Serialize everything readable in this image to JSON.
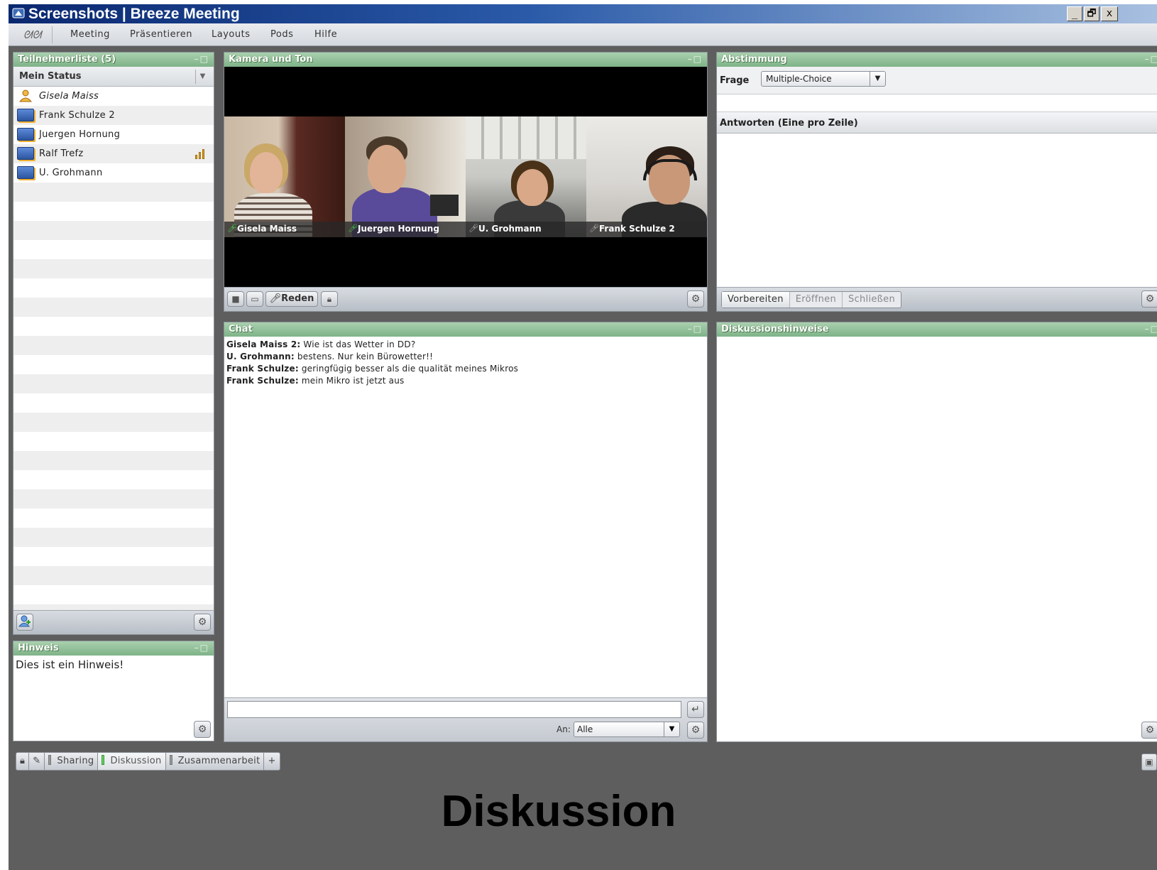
{
  "window": {
    "title": "Screenshots | Breeze Meeting",
    "minimize": "_",
    "restore": "🗗",
    "close": "x"
  },
  "menu": {
    "logo": "ᘛᘛ",
    "items": [
      "Meeting",
      "Präsentieren",
      "Layouts",
      "Pods",
      "Hilfe"
    ]
  },
  "participants": {
    "title": "Teilnehmerliste (5)",
    "controls": "–□",
    "status_label": "Mein Status",
    "status_arrow": "▼",
    "people": [
      {
        "name": "Gisela Maiss",
        "role": "host"
      },
      {
        "name": "Frank Schulze 2",
        "role": "participant"
      },
      {
        "name": "Juergen Hornung",
        "role": "participant"
      },
      {
        "name": "Ralf Trefz",
        "role": "participant",
        "signal": "signal-bars-icon"
      },
      {
        "name": "U. Grohmann",
        "role": "participant"
      }
    ]
  },
  "note": {
    "title": "Hinweis",
    "controls": "–□",
    "text": "Dies ist ein Hinweis!"
  },
  "camera": {
    "title": "Kamera und Ton",
    "controls": "–□",
    "tiles": [
      {
        "name": "Gisela Maiss",
        "mic": "on"
      },
      {
        "name": "Juergen Hornung",
        "mic": "on"
      },
      {
        "name": "U. Grohmann",
        "mic": "off"
      },
      {
        "name": "Frank Schulze 2",
        "mic": "off"
      }
    ],
    "speak_label": "Reden"
  },
  "chat": {
    "title": "Chat",
    "controls": "–□",
    "messages": [
      {
        "sender": "Gisela Maiss 2:",
        "text": " Wie ist das Wetter in DD?"
      },
      {
        "sender": "U. Grohmann:",
        "text": " bestens. Nur kein Bürowetter!!"
      },
      {
        "sender": "Frank Schulze:",
        "text": " geringfügig besser als die qualität meines Mikros"
      },
      {
        "sender": "Frank Schulze:",
        "text": " mein Mikro ist jetzt aus"
      }
    ],
    "input_value": "",
    "to_label": "An:",
    "to_value": "Alle",
    "send_icon": "↵"
  },
  "poll": {
    "title": "Abstimmung",
    "controls": "–□",
    "question_label": "Frage",
    "type_value": "Multiple-Choice",
    "answers_label": "Antworten (Eine pro Zeile)",
    "tabs": [
      "Vorbereiten",
      "Eröffnen",
      "Schließen"
    ],
    "active_tab": "Vorbereiten"
  },
  "discussion": {
    "title": "Diskussionshinweise",
    "controls": "–□"
  },
  "layouts": {
    "tabs": [
      "Sharing",
      "Diskussion",
      "Zusammenarbeit"
    ],
    "active": "Diskussion",
    "add": "+"
  },
  "caption": "Diskussion",
  "colors": {
    "titlebar": "#0a2870",
    "pod_header": "#7fb388",
    "bottom_bar": "#5e5e5e",
    "mic_on": "#4ad04a"
  }
}
